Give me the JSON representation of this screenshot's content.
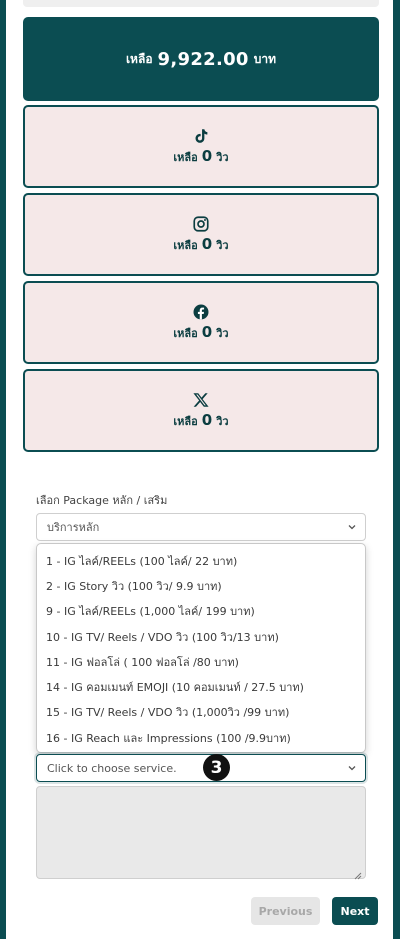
{
  "balance": {
    "prefix": "เหลือ",
    "amount": "9,922.00",
    "suffix": "บาท"
  },
  "platforms": [
    {
      "icon": "tiktok-icon",
      "prefix": "เหลือ",
      "count": "0",
      "suffix": "วิว"
    },
    {
      "icon": "instagram-icon",
      "prefix": "เหลือ",
      "count": "0",
      "suffix": "วิว"
    },
    {
      "icon": "facebook-icon",
      "prefix": "เหลือ",
      "count": "0",
      "suffix": "วิว"
    },
    {
      "icon": "x-icon",
      "prefix": "เหลือ",
      "count": "0",
      "suffix": "วิว"
    }
  ],
  "package": {
    "label": "เลือก Package หลัก / เสริม",
    "selected": "บริการหลัก"
  },
  "service_options": [
    "1 - IG ไลค์/REELs (100 ไลค์/ 22 บาท)",
    "2 - IG Story วิว (100 วิว/ 9.9 บาท)",
    "9 - IG ไลค์/REELs (1,000 ไลค์/ 199 บาท)",
    "10 - IG TV/ Reels / VDO วิว (100 วิว/13 บาท)",
    "11 - IG ฟอลโล่ ( 100 ฟอลโล่ /80 บาท)",
    "14 - IG คอมเมนท์ EMOJI (10 คอมเมนท์ / 27.5 บาท)",
    "15 - IG TV/ Reels / VDO วิว (1,000วิว /99 บาท)",
    "16 - IG Reach และ Impressions (100 /9.9บาท)"
  ],
  "service": {
    "placeholder": "Click to choose service."
  },
  "step_badge": "3",
  "buttons": {
    "previous": "Previous",
    "next": "Next"
  },
  "colors": {
    "primary": "#0b4d52",
    "card_bg": "#f5e8e8"
  }
}
